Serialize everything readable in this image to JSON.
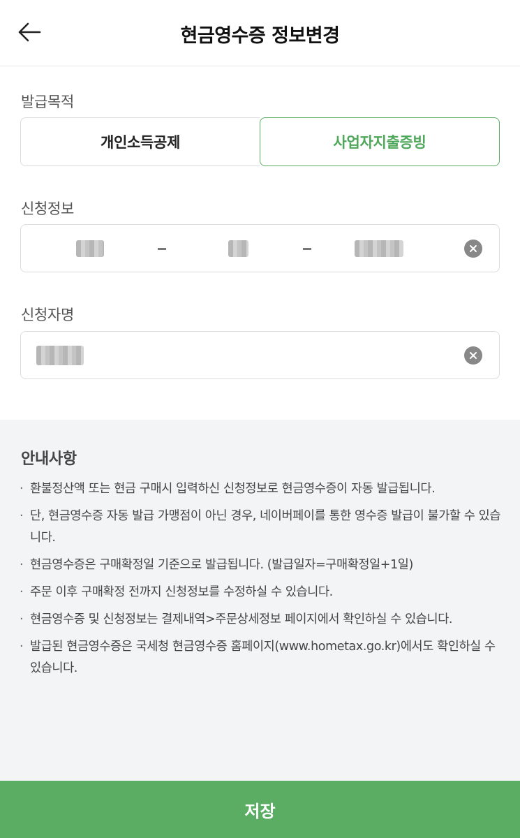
{
  "header": {
    "title": "현금영수증 정보변경",
    "back_icon": "arrow-left-icon"
  },
  "purpose": {
    "label": "발급목적",
    "options": [
      "개인소득공제",
      "사업자지출증빙"
    ],
    "selected": "사업자지출증빙",
    "accent_color": "#5aad63"
  },
  "info": {
    "label": "신청정보",
    "clear_icon": "clear-circle-icon"
  },
  "name": {
    "label": "신청자명",
    "clear_icon": "clear-circle-icon"
  },
  "notice": {
    "title": "안내사항",
    "items": [
      "환불정산액 또는 현금 구매시 입력하신 신청정보로 현금영수증이 자동 발급됩니다.",
      "단, 현금영수증 자동 발급 가맹점이 아닌 경우, 네이버페이를 통한 영수증 발급이 불가할 수 있습니다.",
      "현금영수증은 구매확정일 기준으로 발급됩니다. (발급일자=구매확정일+1일)",
      "주문 이후 구매확정 전까지 신청정보를 수정하실 수 있습니다.",
      "현금영수증 및 신청정보는 결제내역>주문상세정보 페이지에서 확인하실 수 있습니다.",
      "발급된 현금영수증은 국세청 현금영수증 홈페이지(www.hometax.go.kr)에서도 확인하실 수 있습니다."
    ]
  },
  "footer": {
    "save_label": "저장"
  }
}
